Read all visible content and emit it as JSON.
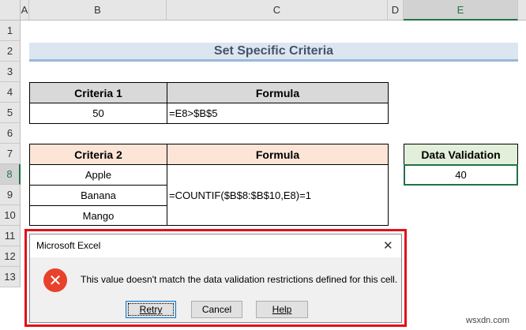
{
  "columns": [
    "A",
    "B",
    "C",
    "D",
    "E"
  ],
  "rows": [
    "1",
    "2",
    "3",
    "4",
    "5",
    "6",
    "7",
    "8",
    "9",
    "10",
    "11",
    "12",
    "13"
  ],
  "title": "Set Specific Criteria",
  "table1": {
    "headers": [
      "Criteria 1",
      "Formula"
    ],
    "value": "50",
    "formula": "=E8>$B$5"
  },
  "table2": {
    "headers": [
      "Criteria 2",
      "Formula"
    ],
    "items": [
      "Apple",
      "Banana",
      "Mango"
    ],
    "formula": "=COUNTIF($B$8:$B$10,E8)=1"
  },
  "validation": {
    "header": "Data Validation",
    "value": "40"
  },
  "dialog": {
    "title": "Microsoft Excel",
    "message": "This value doesn't match the data validation restrictions defined for this cell.",
    "buttons": {
      "retry": "Retry",
      "cancel": "Cancel",
      "help": "Help"
    },
    "close": "✕"
  },
  "watermark": "wsxdn.com"
}
